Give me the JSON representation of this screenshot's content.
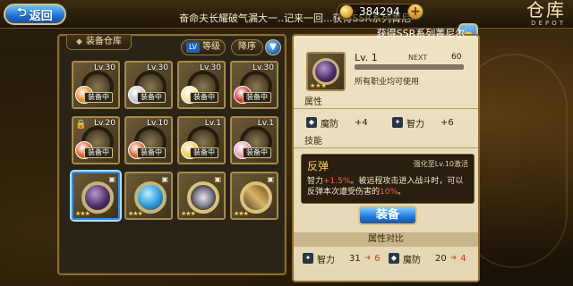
{
  "header": {
    "back_label": "返回",
    "marquee_text": "奋命夫长耀破气漏大一..记来一回...获得SSR系列菁尼尔",
    "coins": "384294",
    "title_cn": "仓库",
    "title_en": "DEPOT"
  },
  "left_panel": {
    "tab_label": "装备仓库",
    "filter_tag": "LV",
    "filter_label": "等级",
    "sort_label": "降序",
    "equipped_badge": "装备中",
    "items": [
      {
        "lv": "Lv.30",
        "equipped": true,
        "avatar_color": "#f08a2a",
        "ring": "default"
      },
      {
        "lv": "Lv.30",
        "equipped": true,
        "avatar_color": "#c7c7d6",
        "ring": "default"
      },
      {
        "lv": "Lv.30",
        "equipped": true,
        "avatar_color": "#f0e3a1",
        "ring": "default"
      },
      {
        "lv": "Lv.30",
        "equipped": true,
        "avatar_color": "#d63636",
        "ring": "default"
      },
      {
        "lv": "Lv.20",
        "equipped": true,
        "avatar_color": "#e0612c",
        "ring": "default",
        "locked": true
      },
      {
        "lv": "Lv.10",
        "equipped": true,
        "avatar_color": "#e0612c",
        "ring": "default"
      },
      {
        "lv": "Lv.1",
        "equipped": true,
        "avatar_color": "#f2d040",
        "ring": "default"
      },
      {
        "lv": "Lv.1",
        "equipped": true,
        "avatar_color": "#f29ac0",
        "ring": "default"
      },
      {
        "lv": "",
        "equipped": false,
        "ring": "dark",
        "stars": "★★★",
        "selected": true
      },
      {
        "lv": "",
        "equipped": false,
        "ring": "gem-blue",
        "stars": "★★★"
      },
      {
        "lv": "",
        "equipped": false,
        "ring": "chain",
        "stars": "★★★"
      },
      {
        "lv": "",
        "equipped": false,
        "ring": "staff",
        "stars": "★★★"
      }
    ]
  },
  "right_panel": {
    "header_label": "获得SSR系列菁尼尔",
    "lv_label": "Lv. 1",
    "next_label": "NEXT",
    "next_value": "60",
    "exp_progress": 0.0,
    "all_use_label": "所有职业均可使用",
    "attr_title": "属性",
    "stats": [
      {
        "icon_name": "magic-defense-icon",
        "label": "魔防",
        "value": "+4"
      },
      {
        "icon_name": "intelligence-icon",
        "label": "智力",
        "value": "+6"
      }
    ],
    "skill_title": "技能",
    "skill": {
      "name": "反弹",
      "requirement": "强化至Lv.10激活",
      "desc_1": "智力",
      "desc_hl1": "+1.5%",
      "desc_2": "。被远程攻击进入战斗时，可以反弹本次遭受伤害的",
      "desc_hl2": "10%",
      "desc_3": "。"
    },
    "equip_button": "装备",
    "compare_title": "属性对比",
    "compare": [
      {
        "icon_name": "intelligence-icon",
        "label": "智力",
        "from": "31",
        "to": "6"
      },
      {
        "icon_name": "magic-defense-icon",
        "label": "魔防",
        "from": "20",
        "to": "4"
      }
    ]
  }
}
